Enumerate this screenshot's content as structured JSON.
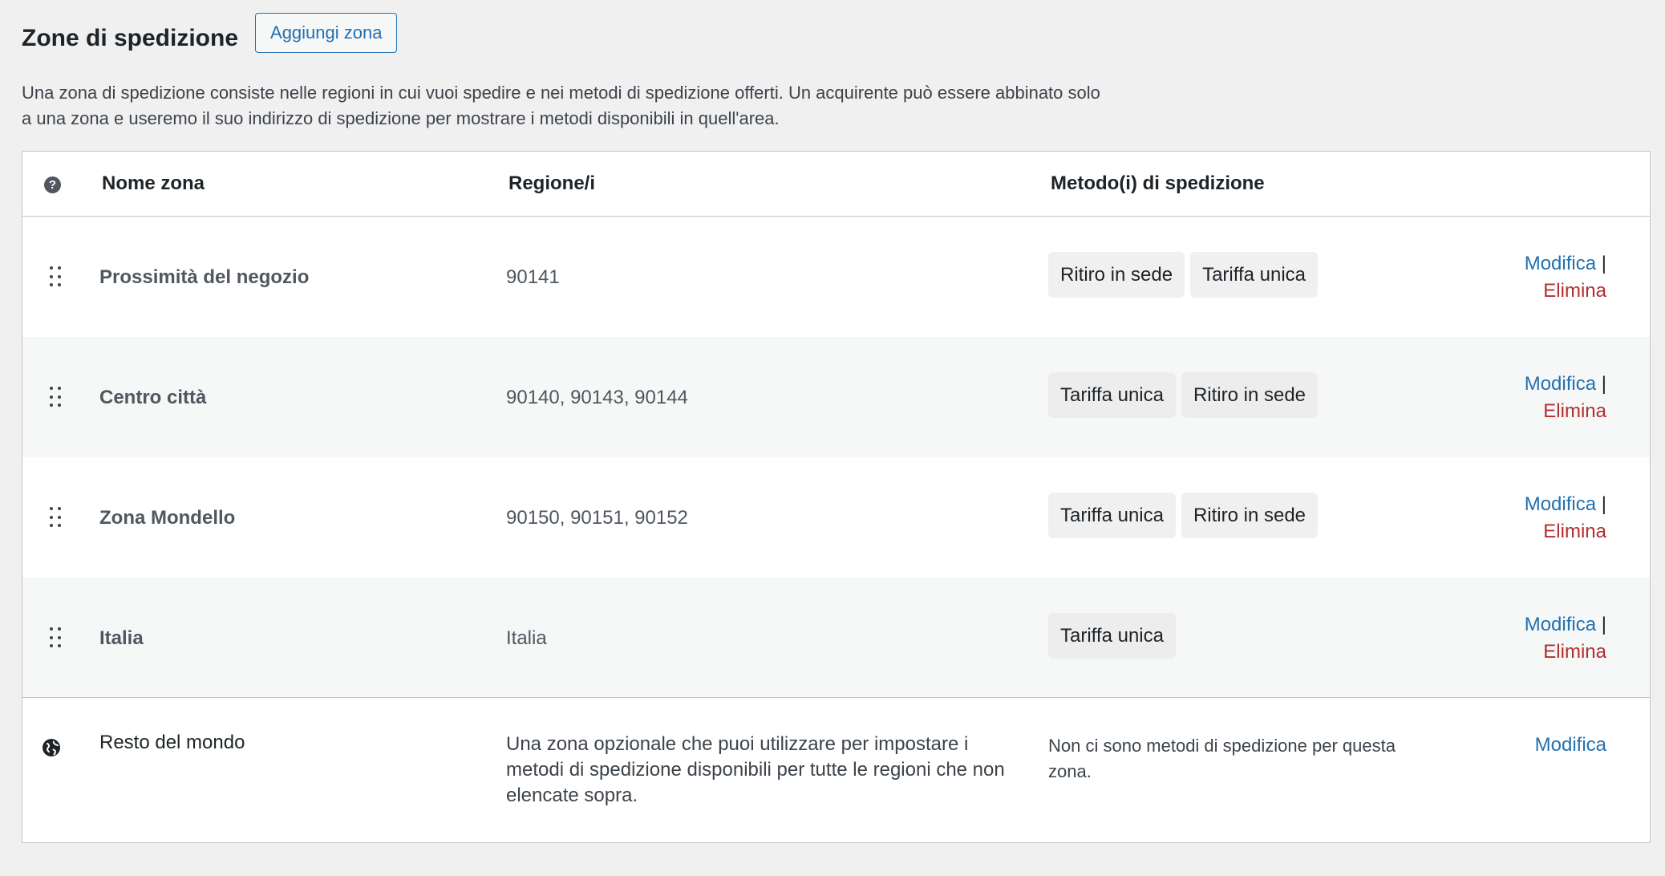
{
  "header": {
    "title": "Zone di spedizione",
    "add_zone_label": "Aggiungi zona",
    "description": "Una zona di spedizione consiste nelle regioni in cui vuoi spedire e nei metodi di spedizione offerti. Un acquirente può essere abbinato solo a una zona e useremo il suo indirizzo di spedizione per mostrare i metodi disponibili in quell'area."
  },
  "table": {
    "columns": {
      "help_icon": "question-icon",
      "name": "Nome zona",
      "regions": "Regione/i",
      "methods": "Metodo(i) di spedizione"
    },
    "rows": [
      {
        "name": "Prossimità del negozio",
        "regions": "90141",
        "methods": [
          "Ritiro in sede",
          "Tariffa unica"
        ],
        "edit": "Modifica",
        "separator": "|",
        "delete": "Elimina"
      },
      {
        "name": "Centro città",
        "regions": "90140, 90143, 90144",
        "methods": [
          "Tariffa unica",
          "Ritiro in sede"
        ],
        "edit": "Modifica",
        "separator": "|",
        "delete": "Elimina"
      },
      {
        "name": "Zona Mondello",
        "regions": "90150, 90151, 90152",
        "methods": [
          "Tariffa unica",
          "Ritiro in sede"
        ],
        "edit": "Modifica",
        "separator": "|",
        "delete": "Elimina"
      },
      {
        "name": "Italia",
        "regions": "Italia",
        "methods": [
          "Tariffa unica"
        ],
        "edit": "Modifica",
        "separator": "|",
        "delete": "Elimina"
      }
    ],
    "rest_of_world": {
      "icon": "globe-icon",
      "name": "Resto del mondo",
      "description": "Una zona opzionale che puoi utilizzare per impostare i metodi di spedizione disponibili per tutte le regioni che non elencate sopra.",
      "methods_text": "Non ci sono metodi di spedizione per questa zona.",
      "edit": "Modifica"
    }
  },
  "colors": {
    "background": "#f0f0f1",
    "link": "#2271b1",
    "delete": "#b32d2e",
    "border": "#c3c4c7"
  }
}
